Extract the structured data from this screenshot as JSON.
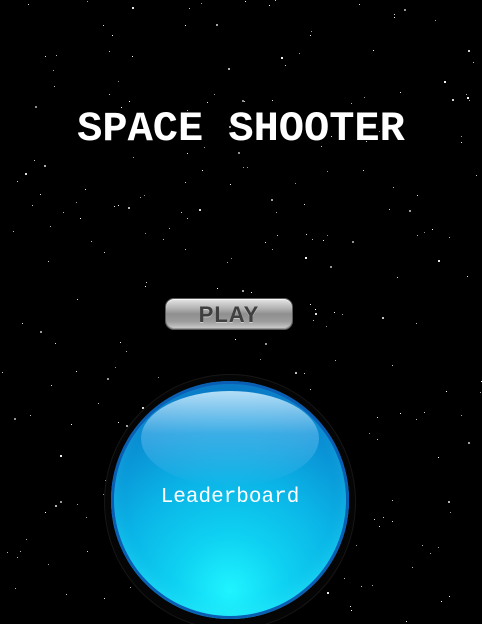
{
  "game": {
    "title": "SPACE SHOOTER",
    "play_label": "PLAY",
    "leaderboard_label": "Leaderboard"
  },
  "colors": {
    "background": "#000000",
    "title": "#ffffff",
    "play_button": "#a6a6a6",
    "play_text": "#3f3f3f",
    "leaderboard_button": "#0ab3e6",
    "leaderboard_text": "#ffffff"
  },
  "icons": {
    "background": "starfield"
  }
}
